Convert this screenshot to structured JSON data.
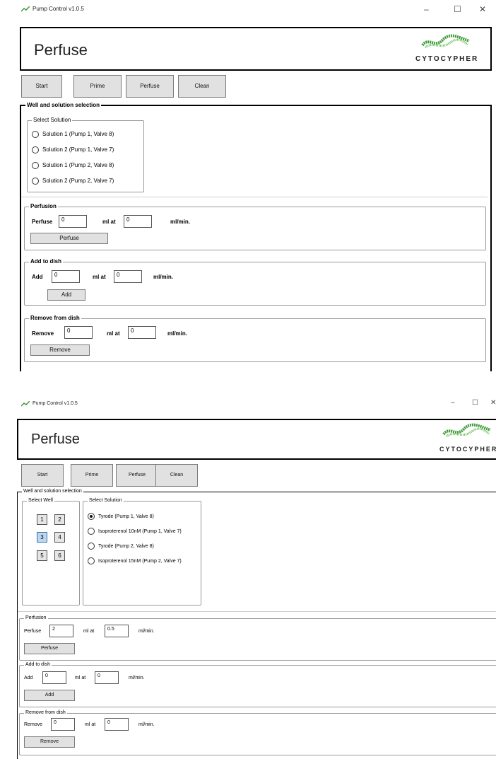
{
  "window1": {
    "title": "Pump Control v1.0.5",
    "header_title": "Perfuse",
    "logo_text": "CYTOCYPHER",
    "toolbar": [
      "Start",
      "Prime",
      "Perfuse",
      "Clean"
    ],
    "well_group_label": "Well and solution selection",
    "solution_group_label": "Select Solution",
    "solutions": [
      "Solution 1 (Pump 1, Valve 8)",
      "Solution 2 (Pump 1, Valve 7)",
      "Solution 1 (Pump 2, Valve 8)",
      "Solution 2 (Pump 2, Valve 7)"
    ],
    "perfusion": {
      "group": "Perfusion",
      "label": "Perfuse",
      "volume": "0",
      "ml_at": "ml at",
      "rate": "0",
      "unit": "ml/min.",
      "button": "Perfuse"
    },
    "add": {
      "group": "Add to dish",
      "label": "Add",
      "volume": "0",
      "ml_at": "ml at",
      "rate": "0",
      "unit": "ml/min.",
      "button": "Add"
    },
    "remove": {
      "group": "Remove from dish",
      "label": "Remove",
      "volume": "0",
      "ml_at": "ml at",
      "rate": "0",
      "unit": "ml/min.",
      "button": "Remove"
    }
  },
  "window2": {
    "title": "Pump Control v1.0.5",
    "header_title": "Perfuse",
    "logo_text": "CYTOCYPHER",
    "toolbar": [
      "Start",
      "Prime",
      "Perfuse",
      "Clean"
    ],
    "well_group_label": "Well and solution selection",
    "well_select_label": "Select Well",
    "wells": [
      "1",
      "2",
      "3",
      "4",
      "5",
      "6"
    ],
    "selected_well": "3",
    "solution_group_label": "Select Solution",
    "solutions": [
      "Tyrode (Pump 1, Valve 8)",
      "Isoproterenol 10nM (Pump 1, Valve 7)",
      "Tyrode (Pump 2, Valve 8)",
      "Isoproterenol 15nM (Pump 2, Valve 7)"
    ],
    "selected_solution_index": 0,
    "perfusion": {
      "group": "Perfusion",
      "label": "Perfuse",
      "volume": "2",
      "ml_at": "ml at",
      "rate": "0.5",
      "unit": "ml/min.",
      "button": "Perfuse"
    },
    "add": {
      "group": "Add to dish",
      "label": "Add",
      "volume": "0",
      "ml_at": "ml at",
      "rate": "0",
      "unit": "ml/min.",
      "button": "Add"
    },
    "remove": {
      "group": "Remove from dish",
      "label": "Remove",
      "volume": "0",
      "ml_at": "ml at",
      "rate": "0",
      "unit": "ml/min.",
      "button": "Remove"
    }
  },
  "window_controls": {
    "minimize": "–",
    "maximize": "☐",
    "close": "✕"
  },
  "colors": {
    "logo_green": "#3f9a3a",
    "selected_well": "#bcd7f0",
    "button_face": "#e1e1e1"
  }
}
